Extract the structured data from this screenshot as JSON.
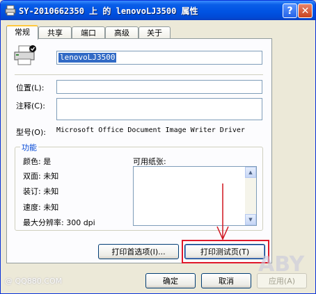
{
  "window": {
    "title": "SY-2010662350 上 的 lenovoLJ3500 属性"
  },
  "tabs": [
    {
      "label": "常规",
      "active": true
    },
    {
      "label": "共享"
    },
    {
      "label": "端口"
    },
    {
      "label": "高级"
    },
    {
      "label": "关于"
    }
  ],
  "general": {
    "printer_name": "lenovoLJ3500",
    "location_label": "位置(L):",
    "location_value": "",
    "comment_label": "注释(C):",
    "comment_value": "",
    "model_label": "型号(O):",
    "model_value": "Microsoft Office Document Image Writer Driver",
    "features": {
      "title": "功能",
      "color": "颜色: 是",
      "duplex": "双面: 未知",
      "staple": "装订: 未知",
      "speed": "速度: 未知",
      "resolution": "最大分辨率: 300 dpi",
      "paper_label": "可用纸张:"
    },
    "preferences_button": "打印首选项(I)...",
    "test_page_button": "打印测试页(T)"
  },
  "footer": {
    "ok": "确定",
    "cancel": "取消",
    "apply": "应用(A)"
  },
  "watermark": {
    "site": "@ QQ880.COM",
    "corner": "ABY"
  },
  "colors": {
    "title_bar": "#0053e3",
    "highlight_box": "#e0182a",
    "focus_tab": "#ffc83c"
  }
}
